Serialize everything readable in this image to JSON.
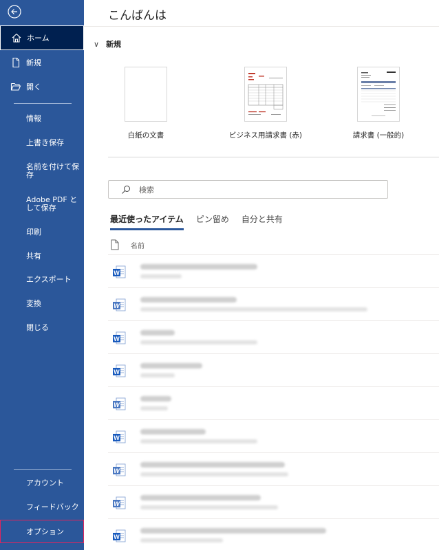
{
  "colors": {
    "sidebar": "#2b579a",
    "active": "#002050",
    "options_border": "#e0245e",
    "word_blue": "#185abd"
  },
  "sidebar": {
    "back_icon": "back-arrow-icon",
    "items": [
      {
        "label": "ホーム",
        "icon": "home-icon"
      },
      {
        "label": "新規",
        "icon": "new-document-icon"
      },
      {
        "label": "開く",
        "icon": "open-folder-icon"
      }
    ],
    "sub_items": [
      "情報",
      "上書き保存",
      "名前を付けて保存",
      "Adobe PDF として保存",
      "印刷",
      "共有",
      "エクスポート",
      "変換",
      "閉じる"
    ],
    "bottom_items": [
      "アカウント",
      "フィードバック",
      "オプション"
    ]
  },
  "main": {
    "greeting": "こんばんは",
    "new_section": "新規",
    "templates": [
      {
        "label": "白紙の文書"
      },
      {
        "label": "ビジネス用請求書 (赤)"
      },
      {
        "label": "請求書 (一般的)"
      }
    ],
    "search_placeholder": "検索",
    "tabs": [
      "最近使ったアイテム",
      "ピン留め",
      "自分と共有"
    ],
    "list_header": "名前"
  }
}
